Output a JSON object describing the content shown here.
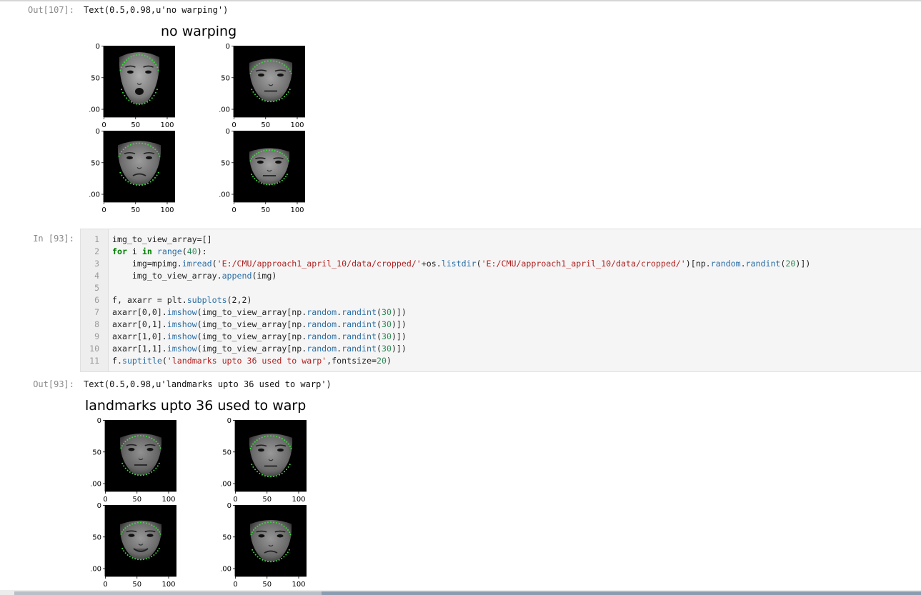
{
  "outputs": [
    {
      "prompt": "Out[107]:",
      "text": "Text(0.5,0.98,u'no warping')",
      "suptitle": "no warping"
    },
    {
      "prompt": "Out[93]:",
      "text": "Text(0.5,0.98,u'landmarks upto 36 used to warp')",
      "suptitle": "landmarks upto 36 used to warp"
    }
  ],
  "input_cell": {
    "prompt": "In [93]:",
    "line_numbers": [
      "1",
      "2",
      "3",
      "4",
      "5",
      "6",
      "7",
      "8",
      "9",
      "10",
      "11"
    ]
  },
  "axes": {
    "x_ticks": [
      "0",
      "50",
      "100"
    ],
    "y_ticks": [
      "0",
      "50",
      "100"
    ]
  },
  "colors": {
    "landmark": "#3cdc3c",
    "image_background": "#000000",
    "code_cell_background": "#f5f5f5"
  }
}
